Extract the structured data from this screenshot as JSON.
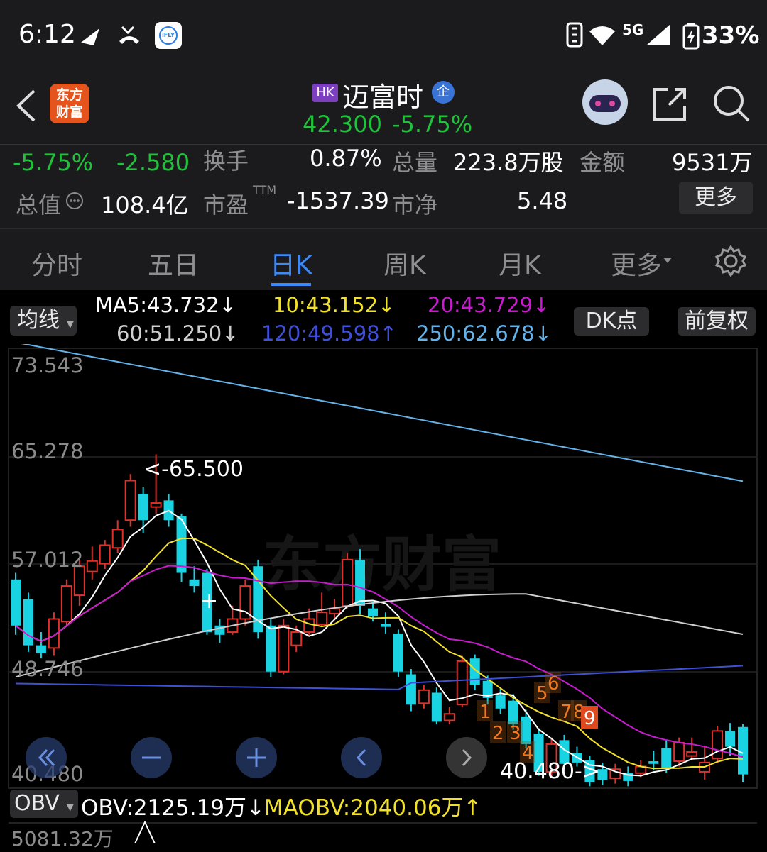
{
  "status_bar": {
    "time": "6:12",
    "network": "5G",
    "battery": "33%"
  },
  "header": {
    "market_badge": "HK",
    "stock_name": "迈富时",
    "enterprise_badge": "企",
    "logo_text_top": "东方",
    "logo_text_bottom": "财富",
    "price": "42.300",
    "change_pct": "-5.75%"
  },
  "quote": {
    "change_pct": "-5.75%",
    "change_amt": "-2.580",
    "turnover_label": "换手",
    "turnover": "0.87%",
    "volume_label": "总量",
    "volume": "223.8万股",
    "amount_label": "金额",
    "amount": "9531万",
    "mktcap_label": "总值",
    "mktcap": "108.4亿",
    "pe_label": "市盈",
    "pe_sup": "TTM",
    "pe": "-1537.39",
    "pb_label": "市净",
    "pb": "5.48",
    "more_button": "更多"
  },
  "tabs": [
    "分时",
    "五日",
    "日K",
    "周K",
    "月K",
    "更多"
  ],
  "active_tab": 2,
  "ma_legend": {
    "type_button": "均线",
    "ma5": "MA5:43.732↓",
    "ma10": "10:43.152↓",
    "ma20": "20:43.729↓",
    "ma60": "60:51.250↓",
    "ma120": "120:49.598↑",
    "ma250": "250:62.678↓",
    "dk_button": "DK点",
    "adjust_button": "前复权"
  },
  "colors": {
    "up": "#e0302a",
    "down": "#19d3e3",
    "ma5": "#ffffff",
    "ma10": "#f2e12b",
    "ma20": "#c81bd0",
    "ma60": "#cfcfcf",
    "ma120": "#3f4fd8",
    "ma250": "#64b2ea",
    "green": "#1fc23a"
  },
  "chart": {
    "y_labels": [
      "73.543",
      "65.278",
      "57.012",
      "48.746",
      "40.480"
    ],
    "high_annotation": "<-65.500",
    "low_annotation": "40.480->",
    "watermark": "东方财富",
    "dk_signals": [
      "1",
      "2",
      "3",
      "4",
      "5",
      "6",
      "7",
      "8",
      "9"
    ]
  },
  "indicator": {
    "button": "OBV",
    "obv": "OBV:2125.19万↓",
    "maobv": "MAOBV:2040.06万↑",
    "top_value": "5081.32万"
  }
}
